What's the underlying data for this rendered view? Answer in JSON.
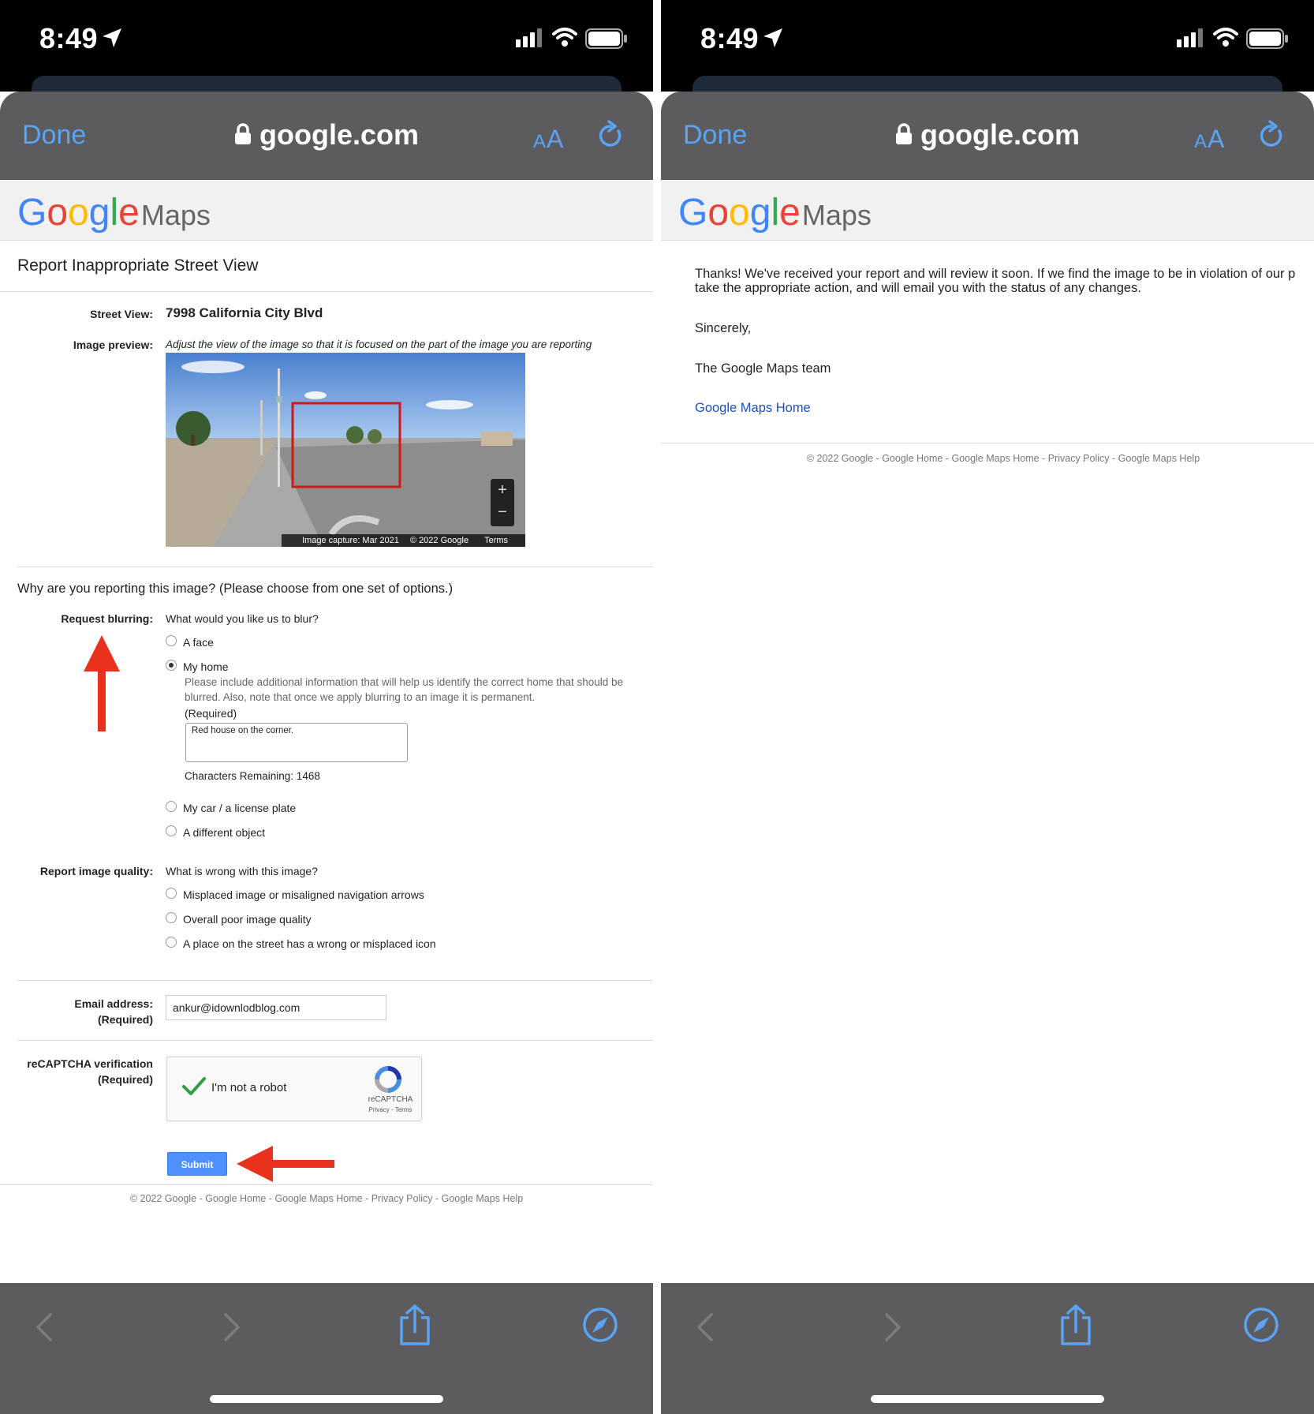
{
  "status": {
    "time": "8:49"
  },
  "browser": {
    "done_label": "Done",
    "url": "google.com",
    "aa_label_big": "A",
    "aa_label_small": "A"
  },
  "logo": {
    "g1": "G",
    "o1": "o",
    "o2": "o",
    "g2": "g",
    "l": "l",
    "e": "e",
    "maps": "Maps"
  },
  "form": {
    "title": "Report Inappropriate Street View",
    "street_view_label": "Street View:",
    "street_view_value": "7998 California City Blvd",
    "image_preview_label": "Image preview:",
    "image_preview_hint": "Adjust the view of the image so that it is focused on the part of the image you are reporting",
    "image_caption_capture": "Image capture: Mar 2021",
    "image_caption_copyright": "© 2022 Google",
    "image_caption_terms": "Terms",
    "zoom_in": "+",
    "zoom_out": "−",
    "reason_question": "Why are you reporting this image?  (Please choose from one set of options.)",
    "blur_label": "Request blurring:",
    "blur_question": "What would you like us to blur?",
    "blur_options": [
      "A face",
      "My home",
      "My car / a license plate",
      "A different object"
    ],
    "blur_selected": "My home",
    "home_help": "Please include additional information that will help us identify the correct home that should be blurred. Also, note that once we apply blurring to an image it is permanent.",
    "required_note": "(Required)",
    "home_details_value": "Red house on the corner.",
    "chars_remaining": "Characters Remaining: 1468",
    "quality_label": "Report image quality:",
    "quality_question": "What is wrong with this image?",
    "quality_options": [
      "Misplaced image or misaligned navigation arrows",
      "Overall poor image quality",
      "A place on the street has a wrong or misplaced icon"
    ],
    "email_label": "Email address:",
    "email_required": "(Required)",
    "email_value": "ankur@idownlodblog.com",
    "recaptcha_label": "reCAPTCHA verification",
    "recaptcha_required": "(Required)",
    "recaptcha_text": "I'm not a robot",
    "recaptcha_brand": "reCAPTCHA",
    "recaptcha_terms": "Privacy - Terms",
    "submit_label": "Submit"
  },
  "footer": "© 2022 Google - Google Home - Google Maps Home - Privacy Policy - Google Maps Help",
  "confirmation": {
    "line1": "Thanks! We've received your report and will review it soon. If we find the image to be in violation of our p",
    "line2": "take the appropriate action, and will email you with the status of any changes.",
    "sincerely": "Sincerely,",
    "team": "The Google Maps team",
    "home_link": "Google Maps Home"
  },
  "colors": {
    "accent": "#5aa3f5",
    "toolbar": "#5c5c5e",
    "submit": "#4d90fe",
    "link": "#1a4fc2",
    "annotation_arrow": "#e8321e"
  }
}
